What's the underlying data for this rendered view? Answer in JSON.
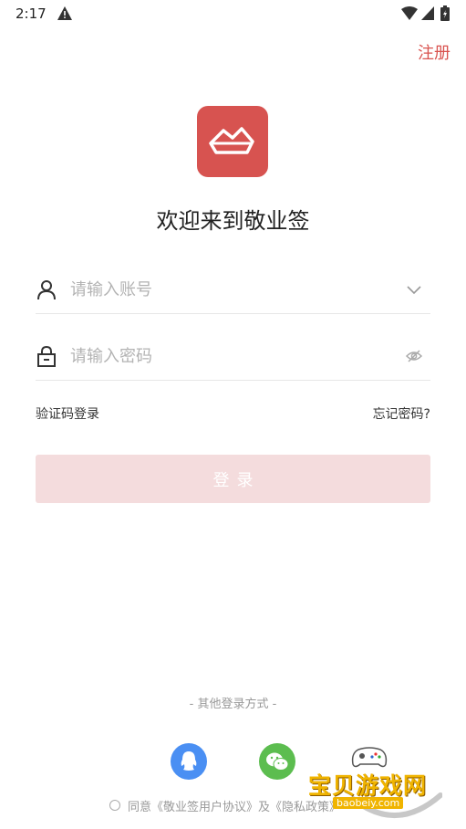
{
  "status_bar": {
    "time": "2:17",
    "icons": [
      "warning-icon",
      "wifi-icon",
      "cell-signal-icon",
      "battery-icon"
    ]
  },
  "header": {
    "register_label": "注册"
  },
  "brand": {
    "welcome_text": "欢迎来到敬业签",
    "logo_color": "#d75350",
    "accent_color": "#d9534f"
  },
  "form": {
    "account": {
      "placeholder": "请输入账号",
      "value": "",
      "icon": "user-icon",
      "action_icon": "chevron-down-icon"
    },
    "password": {
      "placeholder": "请输入密码",
      "value": "",
      "icon": "lock-icon",
      "action_icon": "eye-off-icon"
    },
    "code_login_label": "验证码登录",
    "forgot_password_label": "忘记密码?",
    "login_button_label": "登录"
  },
  "other_login": {
    "label": "- 其他登录方式 -",
    "methods": [
      {
        "name": "QQ",
        "icon": "qq-icon",
        "color": "#4a8ff3"
      },
      {
        "name": "WeChat",
        "icon": "wechat-icon",
        "color": "#5cbd4f"
      }
    ]
  },
  "agreement": {
    "prefix": "同意",
    "user_agreement": "《敬业签用户协议》",
    "joiner": "及",
    "privacy_policy": "《隐私政策》"
  },
  "watermark": {
    "text": "宝贝游戏网",
    "url_text": "baobeiy.com"
  }
}
